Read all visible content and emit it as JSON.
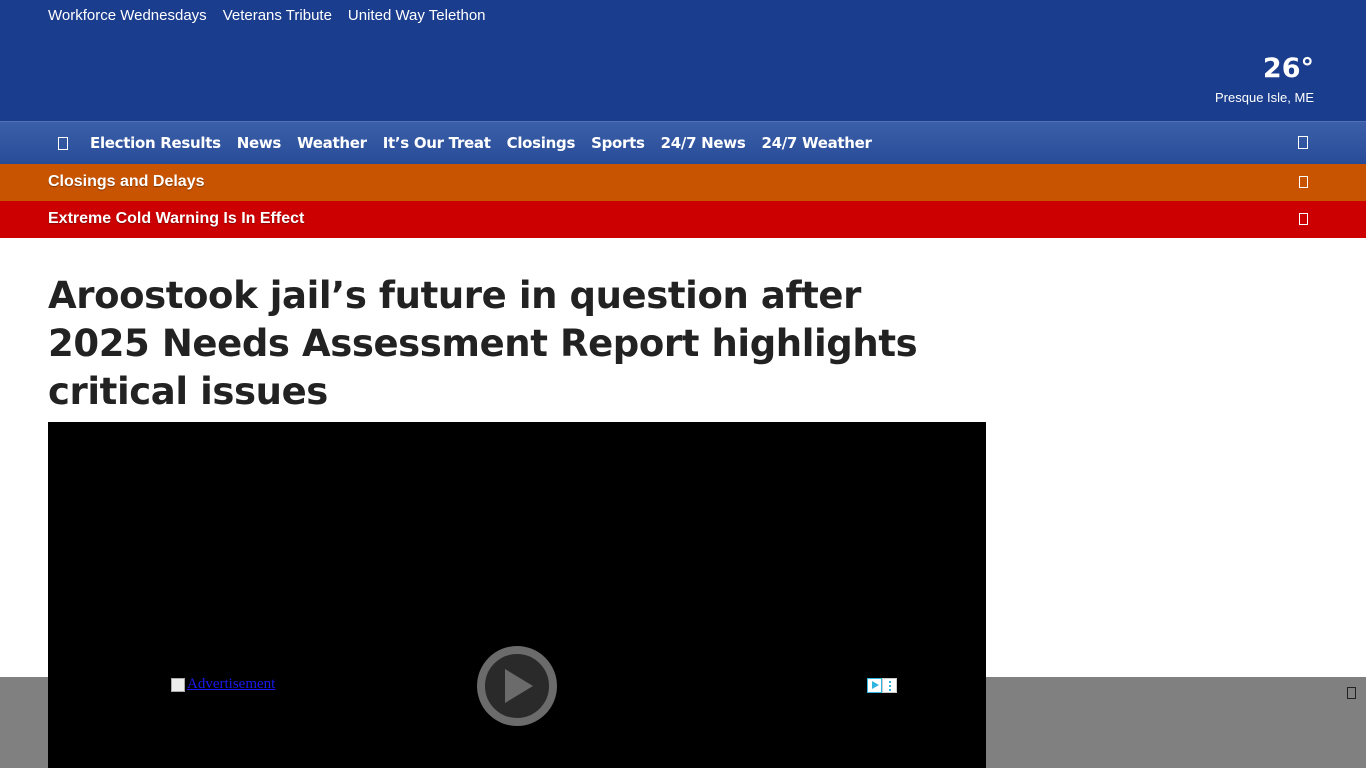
{
  "top_links": [
    "Workforce Wednesdays",
    "Veterans Tribute",
    "United Way Telethon"
  ],
  "weather": {
    "temperature": "26°",
    "location": "Presque Isle, ME"
  },
  "nav": {
    "items": [
      "Election Results",
      "News",
      "Weather",
      "It’s Our Treat",
      "Closings",
      "Sports",
      "24/7 News",
      "24/7 Weather"
    ]
  },
  "alerts": {
    "closings": "Closings and Delays",
    "cold": "Extreme Cold Warning Is In Effect"
  },
  "article": {
    "headline": "Aroostook jail’s future in question after 2025 Needs Assessment Report highlights critical issues"
  },
  "video": {
    "ad_alt": "Advertisement"
  },
  "colors": {
    "header": "#1b3d8d",
    "nav": "#284c98",
    "closings_alert": "#c85300",
    "cold_alert": "#cc0000",
    "ad_band": "#808080"
  }
}
